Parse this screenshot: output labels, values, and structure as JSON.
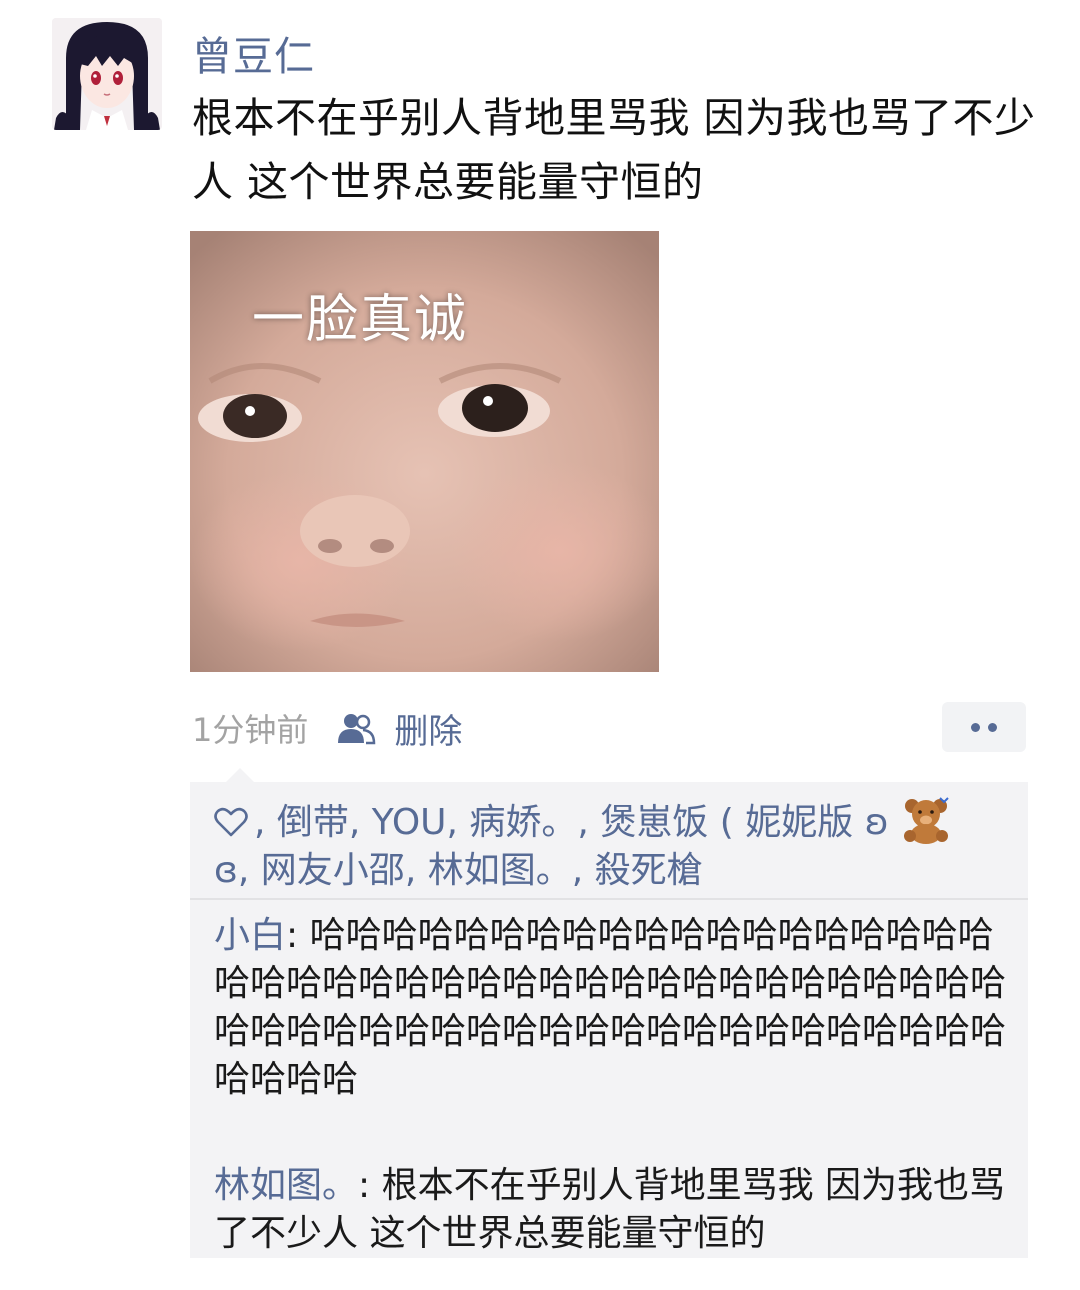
{
  "post": {
    "author": "曾豆仁",
    "text": "根本不在乎别人背地里骂我 因为我也骂了不少人 这个世界总要能量守恒的",
    "image_caption": "一脸真诚",
    "time": "1分钟前",
    "delete_label": "删除"
  },
  "likes": {
    "names": [
      "倒带",
      "YOU",
      "病娇。",
      "煲崽饭 ( 妮妮版 ʚ",
      "ɞ",
      "网友小邵",
      "林如图。",
      "殺死槍"
    ],
    "separator": ", "
  },
  "comments": [
    {
      "author": "小白",
      "text": "哈哈哈哈哈哈哈哈哈哈哈哈哈哈哈哈哈哈哈哈哈哈哈哈哈哈哈哈哈哈哈哈哈哈哈哈哈哈哈哈哈哈哈哈哈哈哈哈哈哈哈哈哈哈哈哈哈哈哈哈哈哈哈哈哈哈哈"
    },
    {
      "author": "林如图。",
      "text": "根本不在乎别人背地里骂我 因为我也骂了不少人 这个世界总要能量守恒的"
    }
  ],
  "colors": {
    "link": "#576b95",
    "muted": "#a3a3a3",
    "box_bg": "#f3f3f5"
  },
  "icons": {
    "privacy": "friends-icon",
    "like": "heart-outline-icon",
    "more": "more-dots-icon",
    "emoji": "teddy-bear-emoji"
  }
}
